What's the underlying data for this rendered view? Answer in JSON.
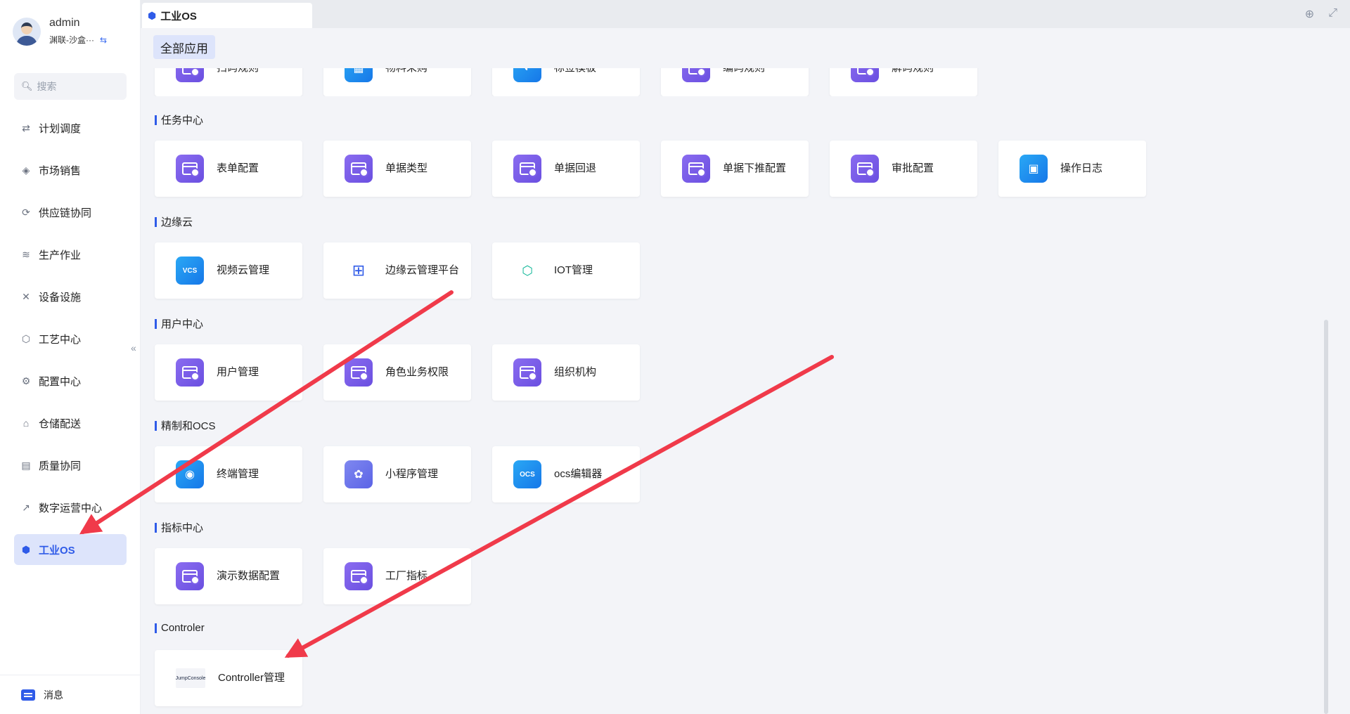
{
  "user": {
    "name": "admin",
    "org": "渊联-沙盒···"
  },
  "search": {
    "placeholder": "搜索"
  },
  "nav": {
    "items": [
      {
        "label": "计划调度",
        "icon": "schedule-icon"
      },
      {
        "label": "市场销售",
        "icon": "market-icon"
      },
      {
        "label": "供应链协同",
        "icon": "supply-chain-icon"
      },
      {
        "label": "生产作业",
        "icon": "layers-icon"
      },
      {
        "label": "设备设施",
        "icon": "tools-icon"
      },
      {
        "label": "工艺中心",
        "icon": "cube-icon"
      },
      {
        "label": "配置中心",
        "icon": "config-icon"
      },
      {
        "label": "仓储配送",
        "icon": "warehouse-icon"
      },
      {
        "label": "质量协同",
        "icon": "document-icon"
      },
      {
        "label": "数字运营中心",
        "icon": "chart-icon"
      },
      {
        "label": "工业OS",
        "icon": "os-icon"
      }
    ],
    "messages": "消息"
  },
  "topbar": {
    "tab_title": "工业OS"
  },
  "main": {
    "all_apps_tab": "全部应用",
    "partial_row": [
      "扫码规则",
      "物料采购",
      "标签模板",
      "编码规则",
      "解码规则"
    ],
    "sections": [
      {
        "title": "任务中心",
        "cards": [
          "表单配置",
          "单据类型",
          "单据回退",
          "单据下推配置",
          "审批配置",
          "操作日志"
        ]
      },
      {
        "title": "边缘云",
        "cards": [
          "视频云管理",
          "边缘云管理平台",
          "IOT管理"
        ]
      },
      {
        "title": "用户中心",
        "cards": [
          "用户管理",
          "角色业务权限",
          "组织机构"
        ]
      },
      {
        "title": "精制和OCS",
        "cards": [
          "终端管理",
          "小程序管理",
          "ocs编辑器"
        ]
      },
      {
        "title": "指标中心",
        "cards": [
          "演示数据配置",
          "工厂指标"
        ]
      },
      {
        "title": "Controler",
        "cards": [
          "Controller管理"
        ]
      }
    ],
    "logo_text": "JumpConsole"
  },
  "colors": {
    "accent": "#2f5be8",
    "arrow": "#f03a4a"
  }
}
